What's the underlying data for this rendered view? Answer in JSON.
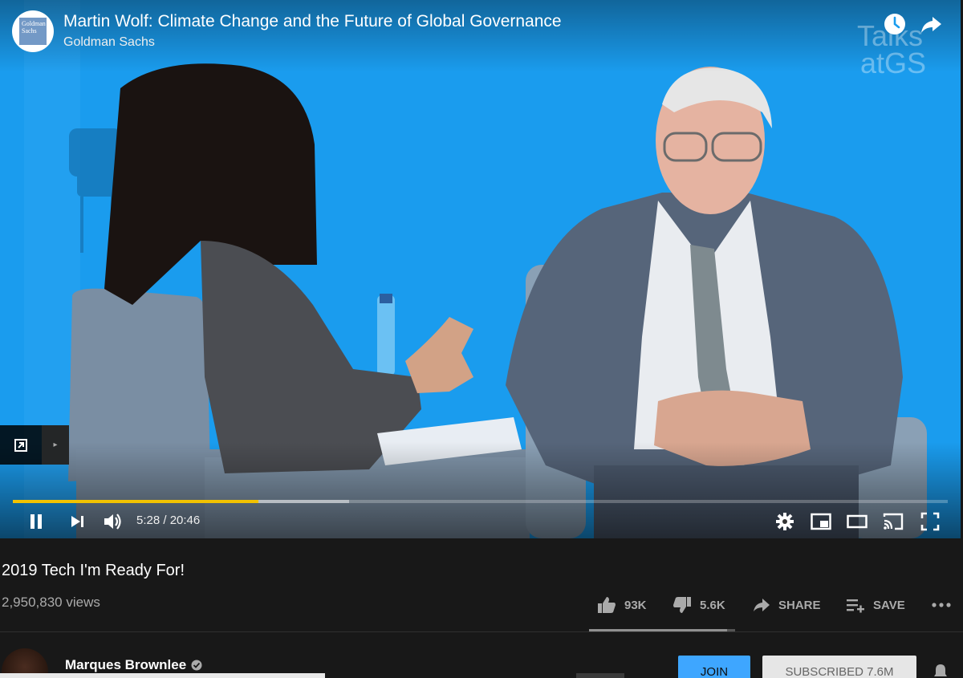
{
  "player": {
    "title": "Martin Wolf: Climate Change and the Future of Global Governance",
    "channel": "Goldman Sachs",
    "logo_text": "Goldman Sachs",
    "watermark_line1": "Talks",
    "watermark_line2": "atGS",
    "time": "5:28 / 20:46",
    "played_fraction": 0.263,
    "buffered_fraction": 0.36,
    "accent": "#f2c200",
    "top_icons": [
      "watch-later-icon",
      "share-icon"
    ],
    "controls": [
      "pause-icon",
      "next-icon",
      "volume-icon",
      "settings-icon",
      "miniplayer-icon",
      "theater-icon",
      "cast-icon",
      "fullscreen-icon"
    ]
  },
  "info": {
    "title": "2019 Tech I'm Ready For!",
    "views": "2,950,830 views",
    "likes": "93K",
    "dislikes": "5.6K",
    "share": "SHARE",
    "save": "SAVE",
    "like_fraction": 0.943
  },
  "owner": {
    "name": "Marques Brownlee",
    "join": "JOIN",
    "subscribed": "SUBSCRIBED  7.6M"
  }
}
